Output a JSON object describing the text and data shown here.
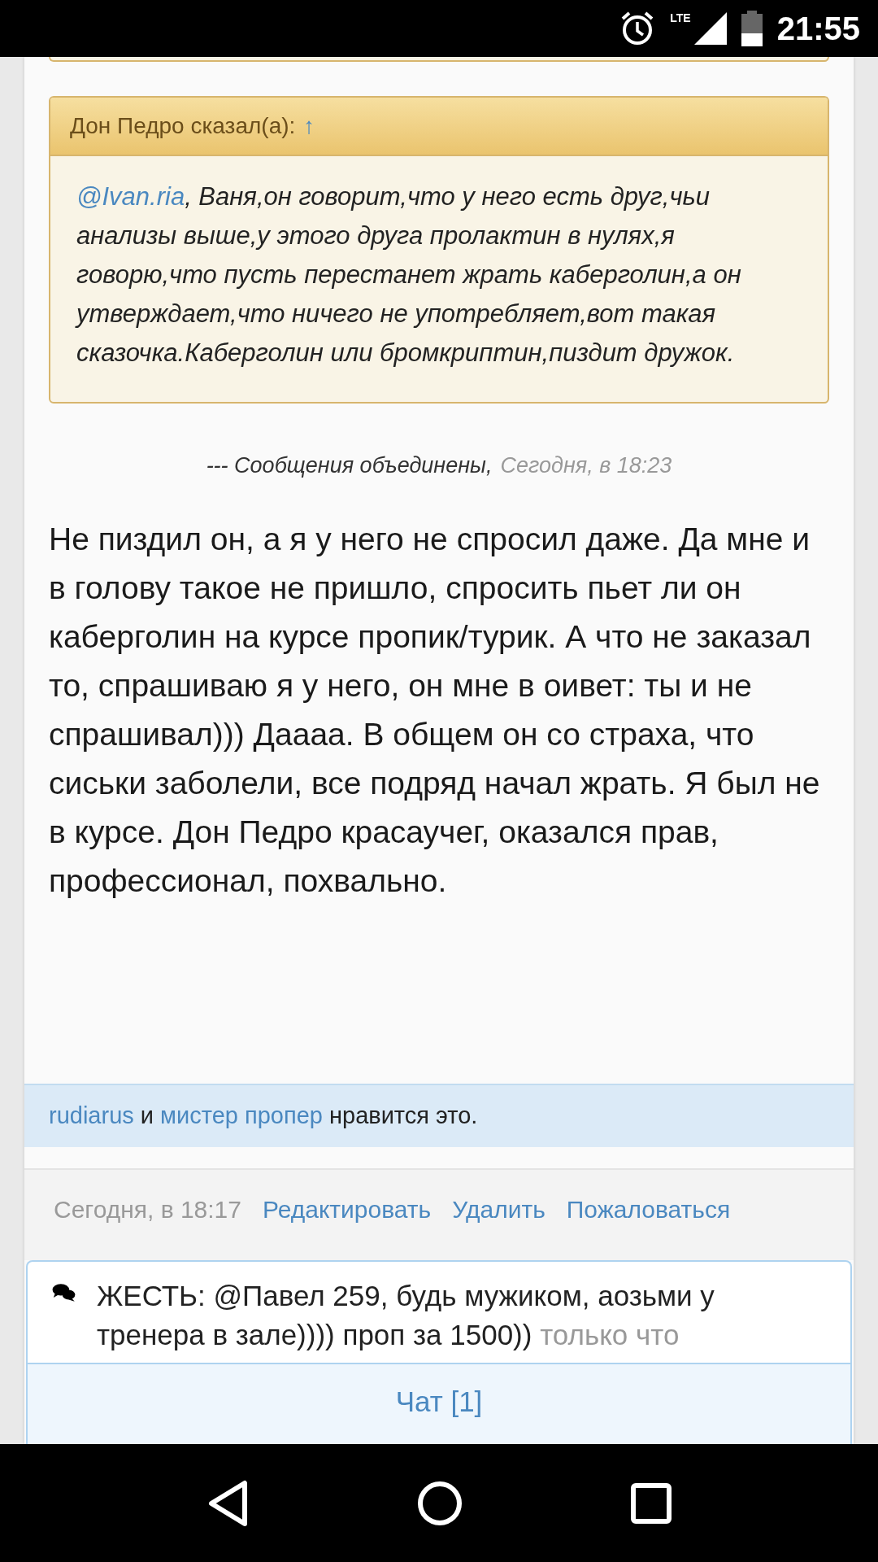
{
  "status_bar": {
    "network": "LTE",
    "time": "21:55"
  },
  "quote": {
    "author": "Дон Педро сказал(а):",
    "jump_link": "↑",
    "mention": "@Ivan.ria",
    "text": ", Ваня,он говорит,что у него есть друг,чьи анализы выше,у этого друга пролактин в нулях,я говорю,что пусть перестанет жрать каберголин,а он утверждает,что ничего не употребляет,вот такая сказочка.Каберголин или бромкриптин,пиздит дружок."
  },
  "merged": {
    "text": "--- Сообщения объединены,",
    "time": "Сегодня, в 18:23"
  },
  "post_text": "Не пиздил он, а я у него не спросил даже. Да мне и в голову такое не пришло, спросить пьет ли он каберголин на курсе пропик/турик. А что не заказал то, спрашиваю я у него, он мне в оивет: ты и не спрашивал))) Даааа. В общем он со страха, что сиськи заболели, все подряд начал жрать. Я был не в курсе. Дон Педро красаучег, оказался прав, профессионал, похвально.",
  "likes": {
    "users": [
      "rudiarus",
      "мистер пропер"
    ],
    "joiner": "и",
    "suffix": "нравится это."
  },
  "footer": {
    "time": "Сегодня, в 18:17",
    "actions": [
      "Редактировать",
      "Удалить",
      "Пожаловаться"
    ]
  },
  "chat": {
    "message": "ЖЕСТЬ: @Павел 259, будь мужиком, аозьми у тренера в зале)))) проп за 1500))",
    "time": "только что",
    "button": "Чат [1]"
  }
}
